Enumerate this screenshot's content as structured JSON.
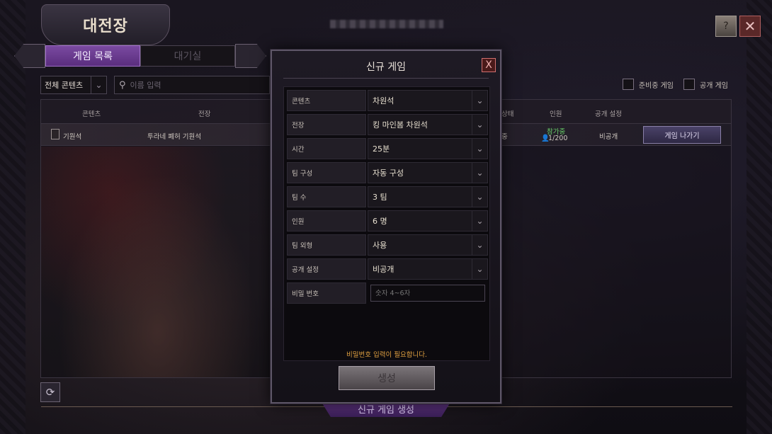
{
  "header": {
    "title": "대전장",
    "tabs": [
      {
        "label": "게임 목록",
        "active": true
      },
      {
        "label": "대기실",
        "active": false
      }
    ]
  },
  "filters": {
    "content_select": "전체 콘텐츠",
    "search_placeholder": "이름 입력",
    "checks": [
      {
        "label": "준비중 게임",
        "checked": false
      },
      {
        "label": "공개 게임",
        "checked": false
      }
    ]
  },
  "table": {
    "columns": [
      "콘텐츠",
      "전장",
      "상태",
      "인원",
      "공개 설정"
    ],
    "rows": [
      {
        "content": "기원석",
        "field": "투라네 폐허 기원석",
        "status": "중",
        "join_status": "참가중",
        "players": "1/200",
        "visibility": "비공개",
        "action": "게임 나가기"
      }
    ]
  },
  "bottom": {
    "create_ribbon": "신규 게임 생성"
  },
  "modal": {
    "title": "신규 게임",
    "close": "X",
    "fields": [
      {
        "label": "콘텐츠",
        "value": "차원석",
        "dropdown": true
      },
      {
        "label": "전장",
        "value": "킹 마인봄 차원석",
        "dropdown": true
      },
      {
        "label": "시간",
        "value": "25분",
        "dropdown": true
      },
      {
        "label": "팀 구성",
        "value": "자동 구성",
        "dropdown": true
      },
      {
        "label": "팀 수",
        "value": "3 팀",
        "dropdown": true
      },
      {
        "label": "인원",
        "value": "6 명",
        "dropdown": true
      },
      {
        "label": "팀 외형",
        "value": "사용",
        "dropdown": true
      },
      {
        "label": "공개 설정",
        "value": "비공개",
        "dropdown": true
      }
    ],
    "password": {
      "label": "비밀 번호",
      "placeholder": "숫자 4~6자"
    },
    "notice": "비밀번호 입력이 필요합니다.",
    "create_button": "생성"
  },
  "icons": {
    "search": "search-icon",
    "chevron": "chevron-down-icon",
    "refresh": "refresh-icon",
    "help": "help-icon",
    "close": "close-icon"
  }
}
